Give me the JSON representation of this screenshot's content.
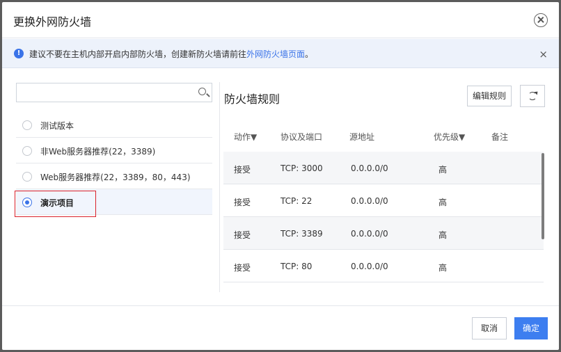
{
  "dialog": {
    "title": "更换外网防火墙"
  },
  "notice": {
    "icon": "info-icon",
    "text_before": "建议不要在主机内部开启内部防火墙，创建新防火墙请前往",
    "link": "外网防火墙页面",
    "text_after": "。"
  },
  "search": {
    "placeholder": "",
    "value": ""
  },
  "list": {
    "items": [
      {
        "label": "测试版本",
        "selected": false
      },
      {
        "label": "非Web服务器推荐(22，3389)",
        "selected": false
      },
      {
        "label": "Web服务器推荐(22，3389，80，443)",
        "selected": false
      },
      {
        "label": "演示项目",
        "selected": true
      }
    ]
  },
  "rules": {
    "title": "防火墙规则",
    "edit_label": "编辑规则",
    "columns": [
      "动作▼",
      "协议及端口",
      "源地址",
      "优先级▼",
      "备注"
    ],
    "rows": [
      {
        "action": "接受",
        "protocol": "TCP: 3000",
        "source": "0.0.0.0/0",
        "priority": "高",
        "note": ""
      },
      {
        "action": "接受",
        "protocol": "TCP: 22",
        "source": "0.0.0.0/0",
        "priority": "高",
        "note": ""
      },
      {
        "action": "接受",
        "protocol": "TCP: 3389",
        "source": "0.0.0.0/0",
        "priority": "高",
        "note": ""
      },
      {
        "action": "接受",
        "protocol": "TCP: 80",
        "source": "0.0.0.0/0",
        "priority": "高",
        "note": ""
      }
    ]
  },
  "footer": {
    "cancel_label": "取消",
    "ok_label": "确定"
  },
  "colors": {
    "accent": "#3a73e8",
    "highlight": "#d9202a"
  }
}
